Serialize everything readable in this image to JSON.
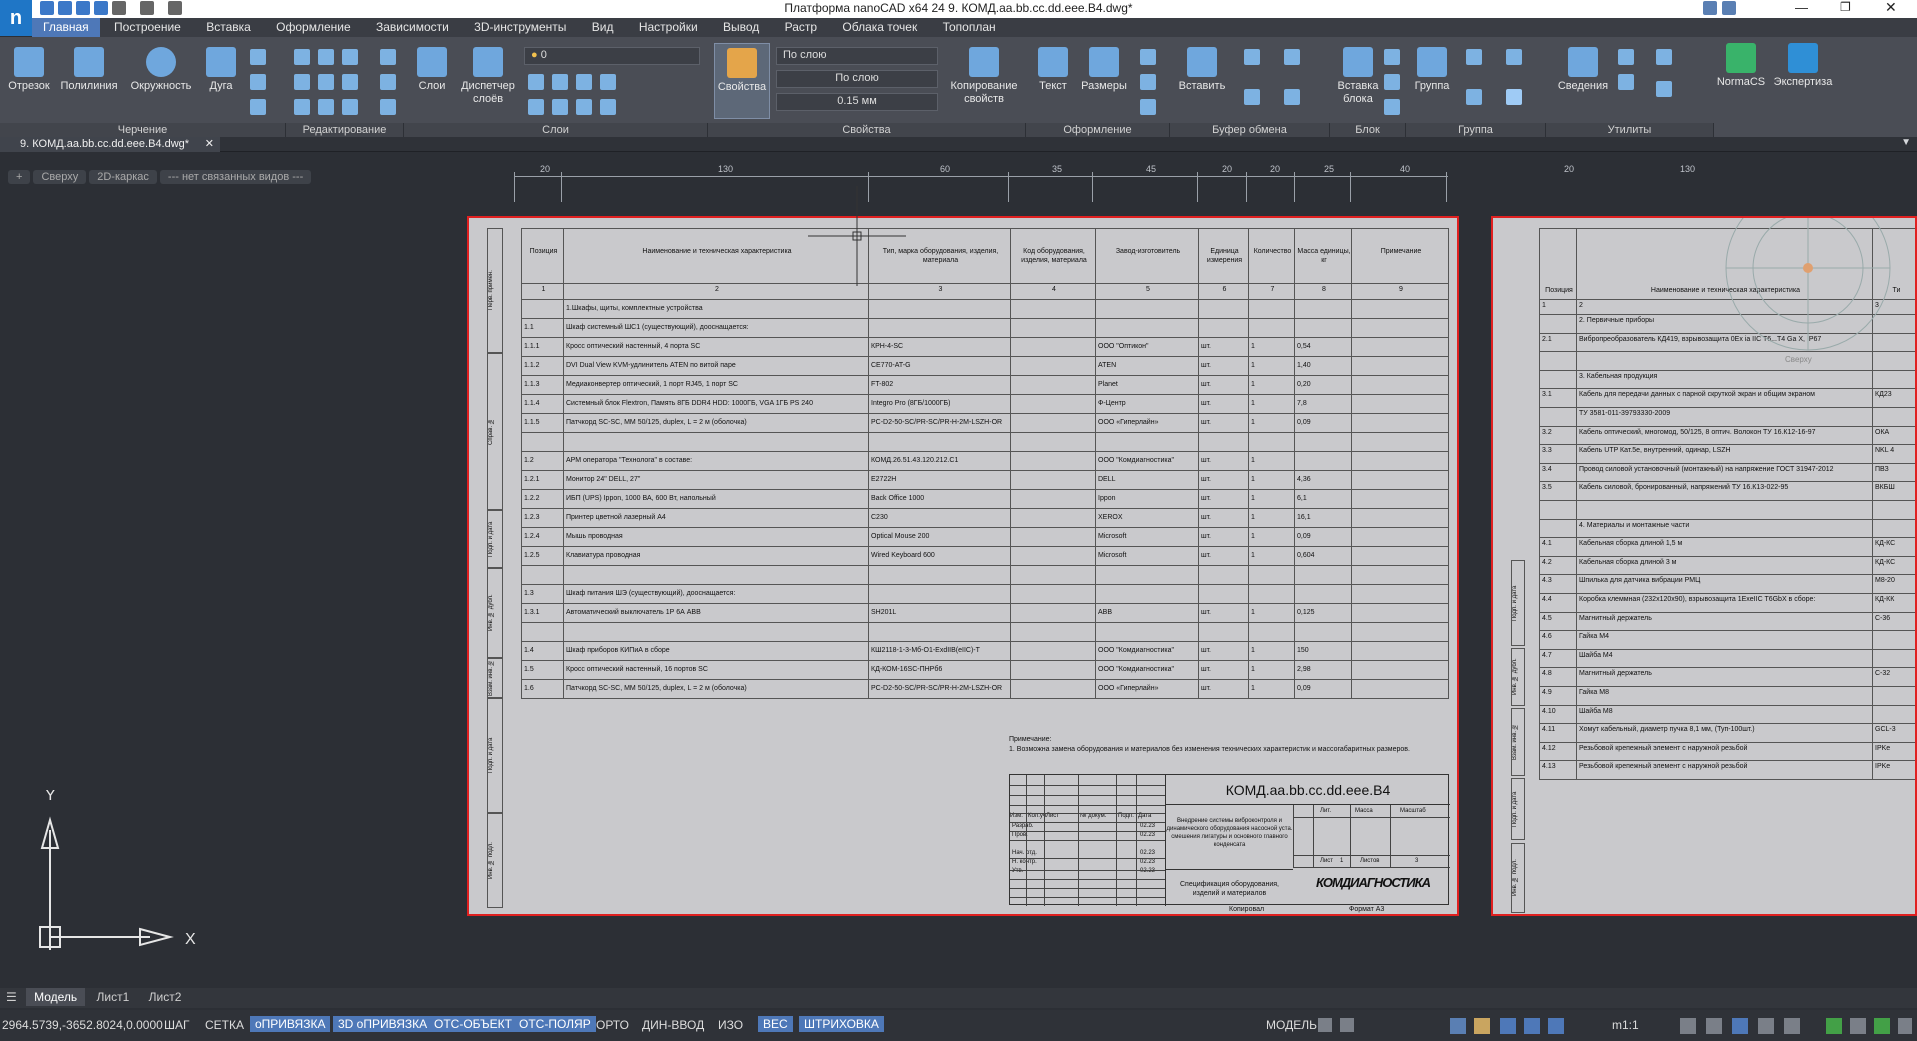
{
  "app": {
    "title": "Платформа nanoCAD x64 24 9. КОМД.aa.bb.cc.dd.eee.B4.dwg*",
    "logo": "n"
  },
  "menu": [
    "Главная",
    "Построение",
    "Вставка",
    "Оформление",
    "Зависимости",
    "3D-инструменты",
    "Вид",
    "Настройки",
    "Вывод",
    "Растр",
    "Облака точек",
    "Топоплан"
  ],
  "ribbon": {
    "draw": {
      "line": "Отрезок",
      "polyline": "Полилиния",
      "circle": "Окружность",
      "arc": "Дуга",
      "group": "Черчение"
    },
    "edit": {
      "group": "Редактирование"
    },
    "layers": {
      "layers": "Слои",
      "manager": "Диспетчер слоёв",
      "group": "Слои",
      "current": "0"
    },
    "props": {
      "props": "Свойства",
      "copy": "Копирование свойств",
      "group": "Свойства",
      "color": "По слою",
      "linetype": "По слою",
      "lineweight": "0.15 мм"
    },
    "annot": {
      "text": "Текст",
      "dims": "Размеры",
      "group": "Оформление"
    },
    "clip": {
      "paste": "Вставить",
      "group": "Буфер обмена"
    },
    "block": {
      "insert": "Вставка блока",
      "group": "Блок"
    },
    "grp": {
      "group_btn": "Группа",
      "group": "Группа"
    },
    "util": {
      "info": "Сведения",
      "group": "Утилиты"
    },
    "normacs": "NormaCS",
    "expert": "Экспертиза"
  },
  "doc_tab": "9. КОМД.aa.bb.cc.dd.eee.B4.dwg*",
  "viewbar": [
    "+",
    "Сверху",
    "2D-каркас",
    "--- нет связанных видов ---"
  ],
  "ruler_top": [
    "20",
    "130",
    "60",
    "35",
    "45",
    "20",
    "20",
    "25",
    "40"
  ],
  "ruler_top2": [
    "20",
    "130"
  ],
  "sheet1": {
    "headers": [
      "Позиция",
      "Наименование и техническая характеристика",
      "Тип, марка оборудования, изделия, материала",
      "Код оборудования, изделия, материала",
      "Завод-изготовитель",
      "Единица измерения",
      "Количество",
      "Масса единицы, кг",
      "Примечание"
    ],
    "nums": [
      "1",
      "2",
      "3",
      "4",
      "5",
      "6",
      "7",
      "8",
      "9"
    ],
    "rows": [
      [
        "",
        "1.Шкафы, щиты, комплектные устройства",
        "",
        "",
        "",
        "",
        "",
        "",
        ""
      ],
      [
        "1.1",
        "Шкаф системный ШС1 (существующий), дооснащается:",
        "",
        "",
        "",
        "",
        "",
        "",
        ""
      ],
      [
        "1.1.1",
        "Кросс оптический настенный, 4 порта SC",
        "КРН-4-SC",
        "",
        "ООО \"Оптикон\"",
        "шт.",
        "1",
        "0,54",
        ""
      ],
      [
        "1.1.2",
        "DVI Dual View KVM-удлинитель ATEN по витой паре",
        "CE770-AT-G",
        "",
        "ATEN",
        "шт.",
        "1",
        "1,40",
        ""
      ],
      [
        "1.1.3",
        "Медиаконвертер оптический, 1 порт RJ45, 1 порт SC",
        "FT-802",
        "",
        "Planet",
        "шт.",
        "1",
        "0,20",
        ""
      ],
      [
        "1.1.4",
        "Системный блок Flextron, Память 8ГБ DDR4 HDD: 1000ГБ, VGA 1ГБ PS 240",
        "Integro Pro (8ГБ/1000ГБ)",
        "",
        "Ф-Центр",
        "шт.",
        "1",
        "7,8",
        ""
      ],
      [
        "1.1.5",
        "Патчкорд SC-SC, MM 50/125, duplex, L = 2 м (оболочка)",
        "PC-D2-50-SC/PR-SC/PR-H-2M-LSZH-OR",
        "",
        "ООО «Гиперлайн»",
        "шт.",
        "1",
        "0,09",
        ""
      ],
      [
        "",
        "",
        "",
        "",
        "",
        "",
        "",
        "",
        ""
      ],
      [
        "1.2",
        "АРМ оператора \"Технолога\" в составе:",
        "КОМД.26.51.43.120.212.С1",
        "",
        "ООО \"Комдиагностика\"",
        "шт.",
        "1",
        "",
        ""
      ],
      [
        "1.2.1",
        "Монитор 24\" DELL, 27\"",
        "E2722H",
        "",
        "DELL",
        "шт.",
        "1",
        "4,36",
        ""
      ],
      [
        "1.2.2",
        "ИБП (UPS) Ippon, 1000 ВА, 600 Вт, напольный",
        "Back Office 1000",
        "",
        "Ippon",
        "шт.",
        "1",
        "6,1",
        ""
      ],
      [
        "1.2.3",
        "Принтер цветной лазерный А4",
        "C230",
        "",
        "XEROX",
        "шт.",
        "1",
        "16,1",
        ""
      ],
      [
        "1.2.4",
        "Мышь проводная",
        "Optical Mouse 200",
        "",
        "Microsoft",
        "шт.",
        "1",
        "0,09",
        ""
      ],
      [
        "1.2.5",
        "Клавиатура проводная",
        "Wired Keyboard 600",
        "",
        "Microsoft",
        "шт.",
        "1",
        "0,604",
        ""
      ],
      [
        "",
        "",
        "",
        "",
        "",
        "",
        "",
        "",
        ""
      ],
      [
        "1.3",
        "Шкаф питания ШЭ (существующий), дооснащается:",
        "",
        "",
        "",
        "",
        "",
        "",
        ""
      ],
      [
        "1.3.1",
        "Автоматический выключатель 1Р 6А ABB",
        "SH201L",
        "",
        "ABB",
        "шт.",
        "1",
        "0,125",
        ""
      ],
      [
        "",
        "",
        "",
        "",
        "",
        "",
        "",
        "",
        ""
      ],
      [
        "1.4",
        "Шкаф приборов КИПиА в сборе",
        "КШ2118-1-3-Мб-О1-ЕхdIIB(eIIC)-T",
        "",
        "ООО \"Комдиагностика\"",
        "шт.",
        "1",
        "150",
        ""
      ],
      [
        "1.5",
        "Кросс оптический настенный, 16 портов SC",
        "КД-КОМ-16SC-ПНРб6",
        "",
        "ООО \"Комдиагностика\"",
        "шт.",
        "1",
        "2,98",
        ""
      ],
      [
        "1.6",
        "Патчкорд SC-SC, MM 50/125, duplex, L = 2 м (оболочка)",
        "PC-D2-50-SC/PR-SC/PR-H-2M-LSZH-OR",
        "",
        "ООО «Гиперлайн»",
        "шт.",
        "1",
        "0,09",
        ""
      ]
    ],
    "note_title": "Примечание:",
    "note_text": "1. Возможна замена оборудования и материалов без изменения технических характеристик и массогабаритных размеров.",
    "side_labels": [
      "Перв. примен.",
      "Справ. №",
      "Подп. и дата",
      "Инв. № дубл.",
      "Взам. инв. №",
      "Подп. и дата",
      "Инв. № подл."
    ],
    "stamp": {
      "code": "КОМД.aa.bb.cc.dd.eee.B4",
      "title": "Внедрение системы виброконтроля и динамического оборудования насосной уста. смешения лигатуры и основного главного конденсата",
      "doc": "Спецификация оборудования, изделий и материалов",
      "col_labels": [
        "Изм.",
        "Кол.уч",
        "Лист",
        "№ докум.",
        "Подп.",
        "Дата"
      ],
      "roles": [
        "Разраб.",
        "Пров.",
        "",
        "Нач. отд.",
        "Н. контр.",
        "Утв."
      ],
      "dates": [
        "02.23",
        "02.23",
        "",
        "02.23",
        "02.23",
        "02.23"
      ],
      "stage_hdr": [
        "Лит.",
        "Масса",
        "Масштаб"
      ],
      "sheet_label": "Лист",
      "sheet_num": "1",
      "sheets_label": "Листов",
      "sheets_num": "3",
      "company": "КОМДИАГНОСТИКА",
      "copied": "Копировал",
      "format": "Формат А3"
    }
  },
  "sheet2": {
    "headers": [
      "Позиция",
      "Наименование и техническая характеристика",
      "Ти"
    ],
    "nums": [
      "1",
      "2",
      "3"
    ],
    "rows": [
      [
        "",
        "2. Первичные приборы",
        ""
      ],
      [
        "2.1",
        "Вибропреобразователь КД419, взрывозащита 0Ex ia IIC T6...T4 Ga X, IP67",
        ""
      ],
      [
        "",
        "",
        ""
      ],
      [
        "",
        "3. Кабельная продукция",
        ""
      ],
      [
        "3.1",
        "Кабель для передачи данных с парной скруткой экран и общим экраном",
        "КД23"
      ],
      [
        "",
        "ТУ 3581-011-39793330-2009",
        ""
      ],
      [
        "3.2",
        "Кабель оптический, многомод, 50/125, 8 оптич. Волокон ТУ 16.К12-16-97",
        "ОКА"
      ],
      [
        "3.3",
        "Кабель UTP Кат.5е, внутренний, одинар, LSZH",
        "NKL 4"
      ],
      [
        "3.4",
        "Провод силовой установочный (монтажный) на напряжение ГОСТ 31947-2012",
        "ПВЗ"
      ],
      [
        "3.5",
        "Кабель силовой, бронированный, напряжений ТУ 16.К13-022-95",
        "ВКБШ"
      ],
      [
        "",
        "",
        ""
      ],
      [
        "",
        "4. Материалы и монтажные части",
        ""
      ],
      [
        "4.1",
        "Кабельная сборка длиной 1,5 м",
        "КД-КС"
      ],
      [
        "4.2",
        "Кабельная сборка длиной 3 м",
        "КД-КС"
      ],
      [
        "4.3",
        "Шпилька для датчика вибрации РМЦ",
        "М8-20"
      ],
      [
        "4.4",
        "Коробка клеммная (232х120х90), взрывозащита 1ExeIIC T6GbX в сборе:",
        "КД-КК"
      ],
      [
        "4.5",
        "Магнитный держатель",
        "С-36"
      ],
      [
        "4.6",
        "Гайка М4",
        ""
      ],
      [
        "4.7",
        "Шайба М4",
        ""
      ],
      [
        "4.8",
        "Магнитный держатель",
        "С-32"
      ],
      [
        "4.9",
        "Гайка М8",
        ""
      ],
      [
        "4.10",
        "Шайба М8",
        ""
      ],
      [
        "4.11",
        "Хомут кабельный, диаметр пучка 8,1 мм, (Туп-100шт.)",
        "GCL-3"
      ],
      [
        "4.12",
        "Резьбовой крепежный элемент с наружной резьбой",
        "IPKe"
      ],
      [
        "4.13",
        "Резьбовой крепежный элемент с наружной резьбой",
        "IPKe"
      ]
    ],
    "side_labels": [
      "Подп. и дата",
      "Инв. № дубл.",
      "Взам. инв. №",
      "Подп. и дата",
      "Инв. № подл."
    ],
    "view_label": "Сверху"
  },
  "ucs": {
    "x": "X",
    "y": "Y"
  },
  "layout_tabs": [
    "Модель",
    "Лист1",
    "Лист2"
  ],
  "status": {
    "coords": "2964.5739,-3652.8024,0.0000",
    "buttons": [
      "ШАГ",
      "СЕТКА",
      "оПРИВЯЗКА",
      "3D оПРИВЯЗКА",
      "ОТС-ОБЪЕКТ",
      "ОТС-ПОЛЯР",
      "ОРТО",
      "ДИН-ВВОД",
      "ИЗО",
      "ВЕС",
      "ШТРИХОВКА"
    ],
    "active": [
      false,
      false,
      true,
      true,
      true,
      true,
      false,
      false,
      false,
      true,
      true
    ],
    "model": "МОДЕЛЬ",
    "scale": "m1:1"
  },
  "colors": {
    "accent": "#4e78b8",
    "border_red": "#e02020",
    "sheet": "#c9c9cc"
  }
}
